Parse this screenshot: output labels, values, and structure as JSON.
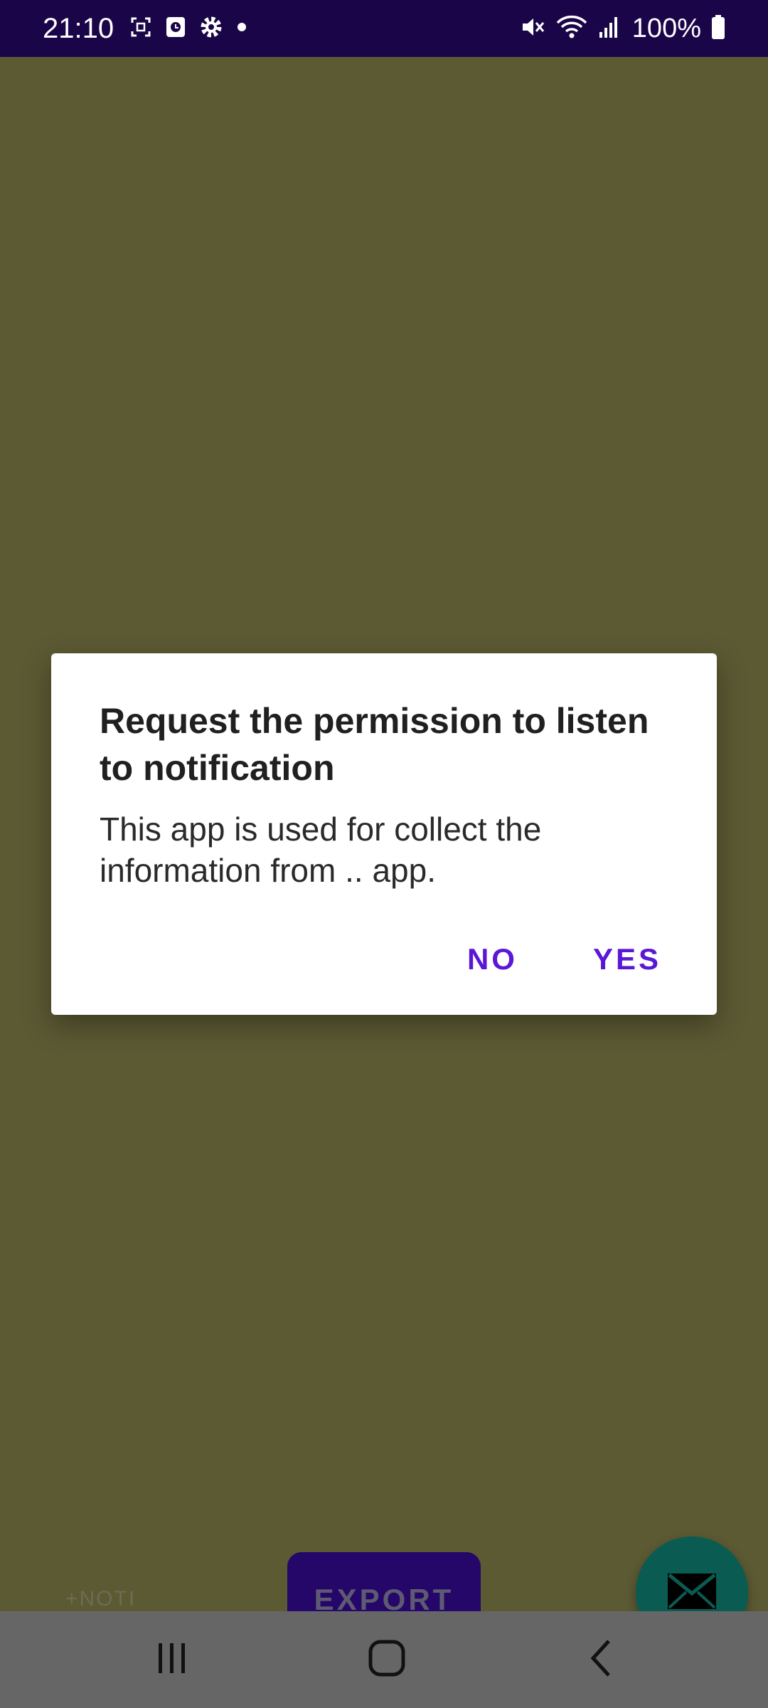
{
  "status_bar": {
    "time": "21:10",
    "battery": "100%",
    "icons": [
      "screenshot-icon",
      "media-icon",
      "settings-gear-icon",
      "dot-icon",
      "mute-icon",
      "wifi-icon",
      "signal-icon",
      "battery-icon"
    ]
  },
  "dialog": {
    "title": "Request the permission to listen to notification",
    "message": "This app is used for collect the information from .. app.",
    "no_label": "NO",
    "yes_label": "YES"
  },
  "app": {
    "noti_label": "+NOTI",
    "export_label": "EXPORT",
    "fab_icon": "mail-icon"
  },
  "navigation": {
    "recents_icon": "recents-icon",
    "home_icon": "home-icon",
    "back_icon": "back-icon"
  },
  "colors": {
    "status_bar": "#1a0548",
    "background": "#5c5a33",
    "accent": "#5b17d6",
    "export_button": "#25076a",
    "fab": "#0a5b52",
    "nav_bar": "#666666"
  }
}
